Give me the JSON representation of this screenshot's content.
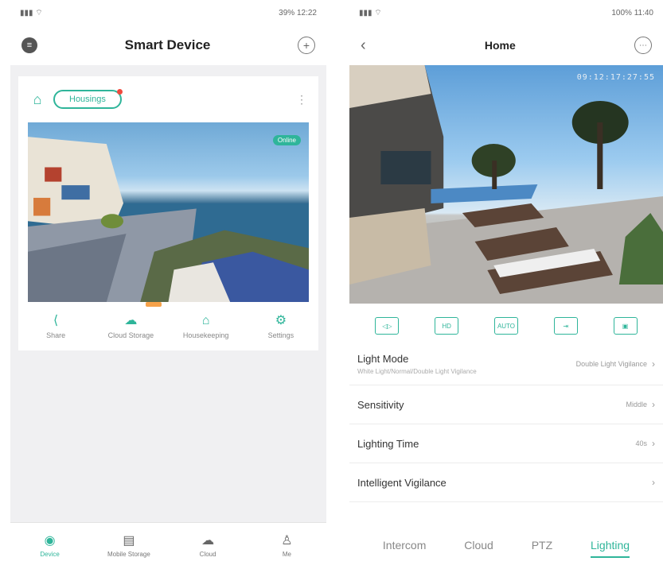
{
  "left": {
    "status_time": "12:22",
    "status_battery": "39%",
    "nav_title": "Smart Device",
    "add_icon": "plus-circle-icon",
    "menu_icon": "menu-icon",
    "card": {
      "group_label": "Housings",
      "more": "⋮",
      "online_badge": "Online",
      "actions": [
        {
          "label": "Share",
          "icon": "share-icon"
        },
        {
          "label": "Cloud Storage",
          "icon": "cloud-icon"
        },
        {
          "label": "Housekeeping",
          "icon": "home-icon"
        },
        {
          "label": "Settings",
          "icon": "gear-icon"
        }
      ]
    },
    "tabs": [
      {
        "label": "Device",
        "icon": "camera-icon"
      },
      {
        "label": "Mobile Storage",
        "icon": "storage-icon"
      },
      {
        "label": "Cloud",
        "icon": "cloud-icon"
      },
      {
        "label": "Me",
        "icon": "person-icon"
      }
    ]
  },
  "right": {
    "status_time": "11:40",
    "status_battery": "100%",
    "nav_title": "Home",
    "back_icon": "back-chevron-icon",
    "menu_icon": "more-circle-icon",
    "timestamp": "09:12:17:27:55",
    "controls": [
      "◁▷",
      "HD",
      "AUTO",
      "⇥",
      "▣"
    ],
    "settings": [
      {
        "title": "Light Mode",
        "subtitle": "White Light/Normal/Double Light Vigilance",
        "value": "Double Light Vigilance"
      },
      {
        "title": "Sensitivity",
        "subtitle": "",
        "value": "Middle"
      },
      {
        "title": "Lighting Time",
        "subtitle": "",
        "value": "40s"
      },
      {
        "title": "Intelligent Vigilance",
        "subtitle": "",
        "value": ""
      }
    ],
    "bottom_tabs": [
      "Intercom",
      "Cloud",
      "PTZ",
      "Lighting"
    ],
    "active_tab": "Lighting"
  },
  "accent_color": "#2fb59a"
}
